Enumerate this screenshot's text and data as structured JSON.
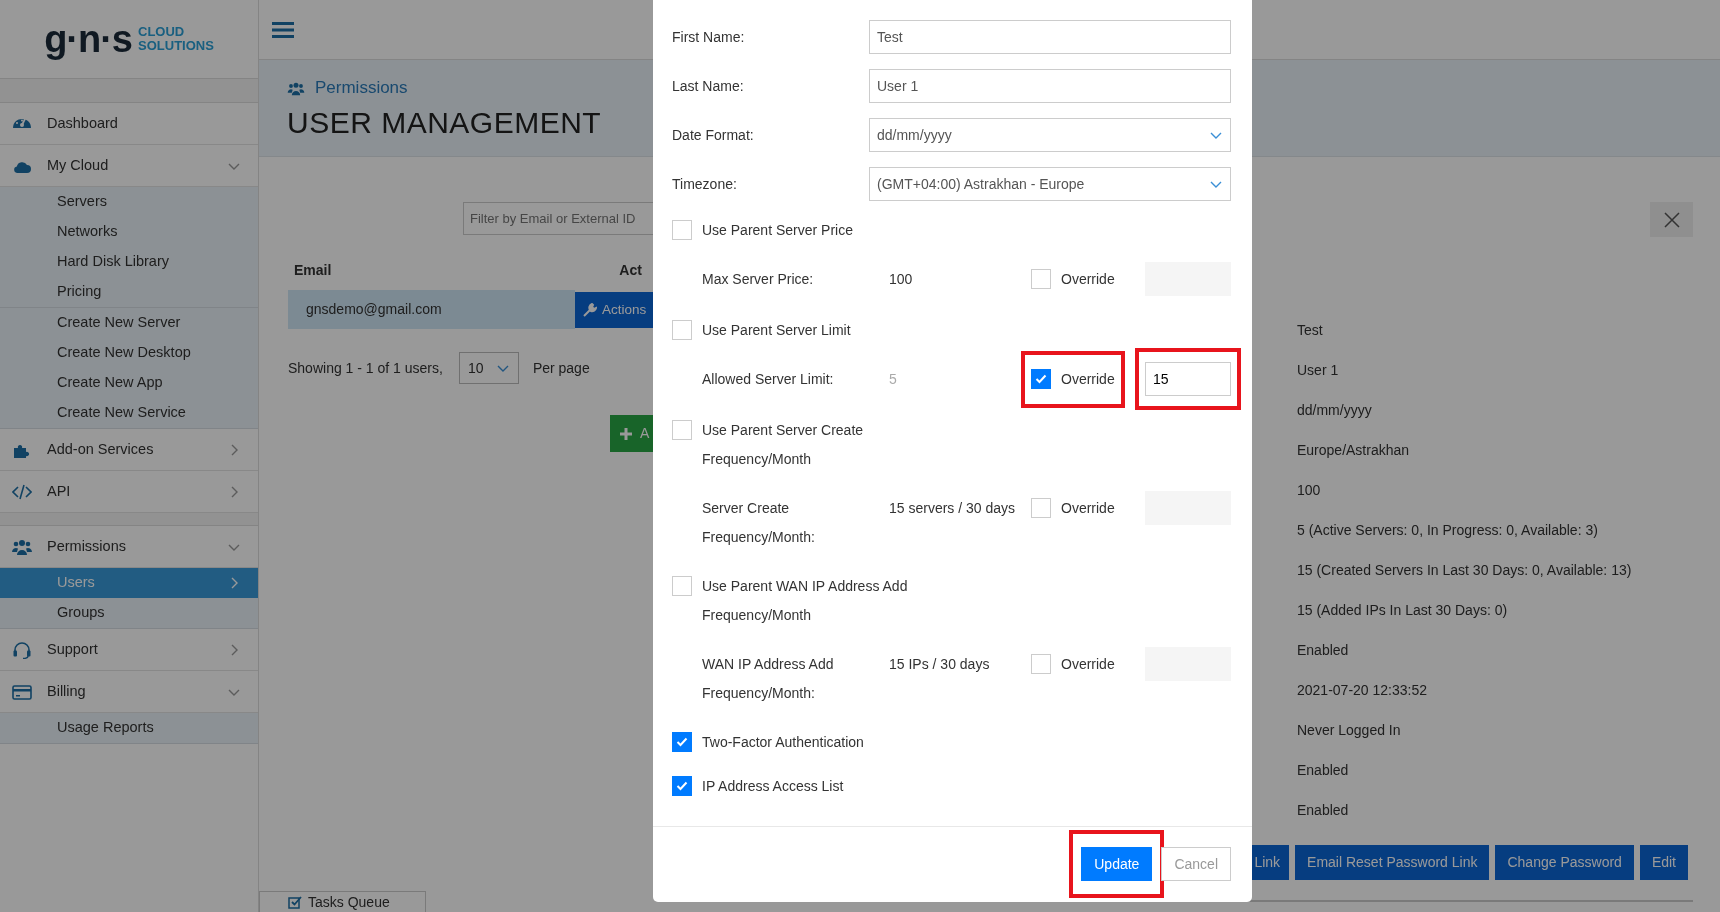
{
  "logo": {
    "wordmark": "g·n·s",
    "tagline": [
      "CLOUD",
      "SOLUTIONS"
    ]
  },
  "sidebar": {
    "sections": [
      {
        "items": [
          {
            "label": "Dashboard",
            "kind": "link"
          },
          {
            "label": "My Cloud",
            "kind": "menu",
            "expanded": true,
            "groups": [
              [
                {
                  "label": "Servers",
                  "selected": false
                },
                {
                  "label": "Networks",
                  "selected": false
                },
                {
                  "label": "Hard Disk Library",
                  "selected": false
                },
                {
                  "label": "Pricing",
                  "selected": false
                }
              ],
              [
                {
                  "label": "Create New Server",
                  "selected": false
                },
                {
                  "label": "Create New Desktop",
                  "selected": false
                },
                {
                  "label": "Create New App",
                  "selected": false
                },
                {
                  "label": "Create New Service",
                  "selected": false
                }
              ]
            ]
          },
          {
            "label": "Add-on Services",
            "kind": "menu",
            "expanded": false
          },
          {
            "label": "API",
            "kind": "menu",
            "expanded": false
          }
        ]
      },
      {
        "items": [
          {
            "label": "Permissions",
            "kind": "menu",
            "expanded": true,
            "groups": [
              [
                {
                  "label": "Users",
                  "selected": true
                },
                {
                  "label": "Groups",
                  "selected": false
                }
              ]
            ]
          },
          {
            "label": "Support",
            "kind": "menu",
            "expanded": false
          },
          {
            "label": "Billing",
            "kind": "menu",
            "expanded": true,
            "groups": [
              [
                {
                  "label": "Usage Reports",
                  "selected": false
                }
              ]
            ]
          }
        ]
      }
    ]
  },
  "page_header": {
    "breadcrumb": "Permissions",
    "title": "USER MANAGEMENT"
  },
  "filter": {
    "placeholder": "Filter by Email or External ID"
  },
  "users_table": {
    "columns": [
      "Email",
      "Act"
    ],
    "rows": [
      {
        "email": "gnsdemo@gmail.com",
        "action": "Actions",
        "selected": true
      }
    ]
  },
  "pagination": {
    "summary": "Showing 1 - 1 of 1 users,",
    "per_page": "10",
    "per_page_label": "Per page"
  },
  "add_button": {
    "label": "A"
  },
  "tasks_tab": {
    "label": "Tasks Queue"
  },
  "details": {
    "values": [
      "Test",
      "User 1",
      "dd/mm/yyyy",
      "Europe/Astrakhan",
      "100",
      "5 (Active Servers: 0, In Progress: 0, Available: 3)",
      "15 (Created Servers In Last 30 Days: 0, Available: 13)",
      "15 (Added IPs In Last 30 Days: 0)",
      "Enabled",
      "2021-07-20 12:33:52",
      "Never Logged In",
      "Enabled",
      "Enabled"
    ],
    "actions": [
      "Link",
      "Email Reset Password Link",
      "Change Password",
      "Edit"
    ]
  },
  "modal": {
    "rows": [
      {
        "kind": "text",
        "label": "First Name:",
        "value": "Test"
      },
      {
        "kind": "text",
        "label": "Last Name:",
        "value": "User 1"
      },
      {
        "kind": "select",
        "label": "Date Format:",
        "value": "dd/mm/yyyy"
      },
      {
        "kind": "select",
        "label": "Timezone:",
        "value": "(GMT+04:00) Astrakhan - Europe"
      },
      {
        "kind": "toggle",
        "label": "Use Parent Server Price",
        "checked": false
      },
      {
        "kind": "limit",
        "label": "Max Server Price:",
        "value": "100",
        "dimmed": false,
        "override": {
          "label": "Override",
          "checked": false,
          "highlighted": false
        },
        "input": {
          "enabled": false,
          "highlighted": false
        }
      },
      {
        "kind": "toggle",
        "label": "Use Parent Server Limit",
        "checked": false
      },
      {
        "kind": "limit",
        "label": "Allowed Server Limit:",
        "value": "5",
        "dimmed": true,
        "override": {
          "label": "Override",
          "checked": true,
          "highlighted": true
        },
        "input": {
          "value": "15",
          "enabled": true,
          "highlighted": true
        }
      },
      {
        "kind": "toggle",
        "label": "Use Parent Server Create\nFrequency/Month",
        "checked": false
      },
      {
        "kind": "limit",
        "label": "Server Create\nFrequency/Month:",
        "value": "15 servers / 30 days",
        "dimmed": false,
        "override": {
          "label": "Override",
          "checked": false,
          "highlighted": false
        },
        "input": {
          "enabled": false,
          "highlighted": false
        }
      },
      {
        "kind": "toggle",
        "label": "Use Parent WAN IP Address Add\nFrequency/Month",
        "checked": false
      },
      {
        "kind": "limit",
        "label": "WAN IP Address Add\nFrequency/Month:",
        "value": "15 IPs / 30 days",
        "dimmed": false,
        "override": {
          "label": "Override",
          "checked": false,
          "highlighted": false
        },
        "input": {
          "enabled": false,
          "highlighted": false
        }
      },
      {
        "kind": "toggle",
        "label": "Two-Factor Authentication",
        "checked": true
      },
      {
        "kind": "toggle",
        "label": "IP Address Access List",
        "checked": true
      }
    ],
    "buttons": [
      {
        "label": "Update",
        "kind": "primary",
        "highlighted": true
      },
      {
        "label": "Cancel",
        "kind": "secondary",
        "highlighted": false
      }
    ]
  }
}
